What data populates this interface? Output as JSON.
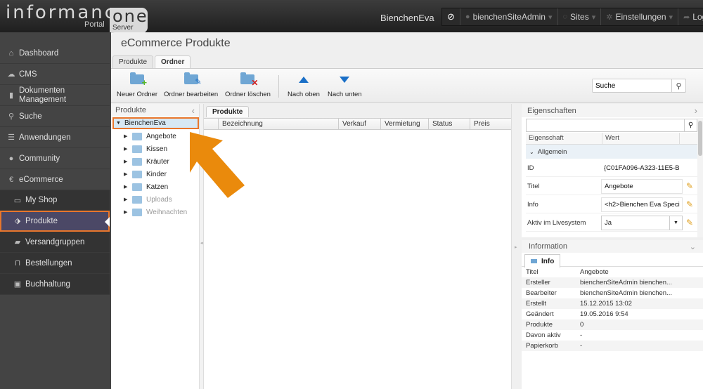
{
  "header": {
    "logo_main": "informance",
    "logo_sub": "Portal",
    "logo_badge": "one",
    "logo_badge_sub": "Server",
    "site_name": "BienchenEva",
    "nav": [
      {
        "icon": "block-icon",
        "label": ""
      },
      {
        "icon": "user-icon",
        "label": "bienchenSiteAdmin"
      },
      {
        "icon": "globe-icon",
        "label": "Sites"
      },
      {
        "icon": "gear-icon",
        "label": "Einstellungen"
      },
      {
        "icon": "logout-icon",
        "label": "Logout"
      }
    ]
  },
  "sidebar": {
    "items": [
      {
        "icon": "home-icon",
        "label": "Dashboard"
      },
      {
        "icon": "cloud-icon",
        "label": "CMS"
      },
      {
        "icon": "bookmark-icon",
        "label": "Dokumenten",
        "label2": "Management"
      },
      {
        "icon": "search-icon",
        "label": "Suche"
      },
      {
        "icon": "menu-icon",
        "label": "Anwendungen"
      },
      {
        "icon": "user-icon",
        "label": "Community"
      },
      {
        "icon": "euro-icon",
        "label": "eCommerce"
      }
    ],
    "sub_items": [
      {
        "icon": "monitor-icon",
        "label": "My Shop"
      },
      {
        "icon": "tags-icon",
        "label": "Produkte",
        "active": true
      },
      {
        "icon": "truck-icon",
        "label": "Versandgruppen"
      },
      {
        "icon": "cart-icon",
        "label": "Bestellungen"
      },
      {
        "icon": "money-icon",
        "label": "Buchhaltung"
      }
    ]
  },
  "main": {
    "title": "eCommerce Produkte",
    "tabs": [
      {
        "label": "Produkte",
        "active": false
      },
      {
        "label": "Ordner",
        "active": true
      }
    ],
    "toolbar": {
      "new_folder": "Neuer Ordner",
      "edit_folder": "Ordner bearbeiten",
      "delete_folder": "Ordner löschen",
      "move_up": "Nach oben",
      "move_down": "Nach unten",
      "search_value": "Suche"
    }
  },
  "tree": {
    "title": "Produkte",
    "root": "BienchenEva",
    "nodes": [
      {
        "label": "Angebote",
        "disabled": false
      },
      {
        "label": "Kissen",
        "disabled": false
      },
      {
        "label": "Kräuter",
        "disabled": false
      },
      {
        "label": "Kinder",
        "disabled": false
      },
      {
        "label": "Katzen",
        "disabled": false
      },
      {
        "label": "Uploads",
        "disabled": true
      },
      {
        "label": "Weihnachten",
        "disabled": true
      }
    ]
  },
  "grid": {
    "tab": "Produkte",
    "columns": [
      "Bezeichnung",
      "Verkauf",
      "Vermietung",
      "Status",
      "Preis"
    ],
    "rows": []
  },
  "properties": {
    "title": "Eigenschaften",
    "col_key": "Eigenschaft",
    "col_value": "Wert",
    "group": "Allgemein",
    "rows": [
      {
        "key": "ID",
        "value": "{C01FA096-A323-11E5-B",
        "editable": false
      },
      {
        "key": "Titel",
        "value": "Angebote",
        "editable": true
      },
      {
        "key": "Info",
        "value": "<h2>Bienchen Eva Speci",
        "editable": true
      },
      {
        "key": "Aktiv im Livesystem",
        "value": "Ja",
        "editable": true,
        "select": true
      }
    ]
  },
  "information": {
    "title": "Information",
    "tab": "Info",
    "rows": [
      {
        "key": "Titel",
        "value": "Angebote"
      },
      {
        "key": "Ersteller",
        "value": "bienchenSiteAdmin bienchen..."
      },
      {
        "key": "Bearbeiter",
        "value": "bienchenSiteAdmin bienchen..."
      },
      {
        "key": "Erstellt",
        "value": "15.12.2015 13:02"
      },
      {
        "key": "Geändert",
        "value": "19.05.2016 9:54"
      },
      {
        "key": "Produkte",
        "value": "0"
      },
      {
        "key": "Davon aktiv",
        "value": "-"
      },
      {
        "key": "Papierkorb",
        "value": "-"
      }
    ]
  },
  "colors": {
    "highlight": "#e8762c",
    "sidebar_bg": "#444444",
    "active_item_bg": "#4b4866",
    "accent_blue": "#1a6fc7"
  }
}
